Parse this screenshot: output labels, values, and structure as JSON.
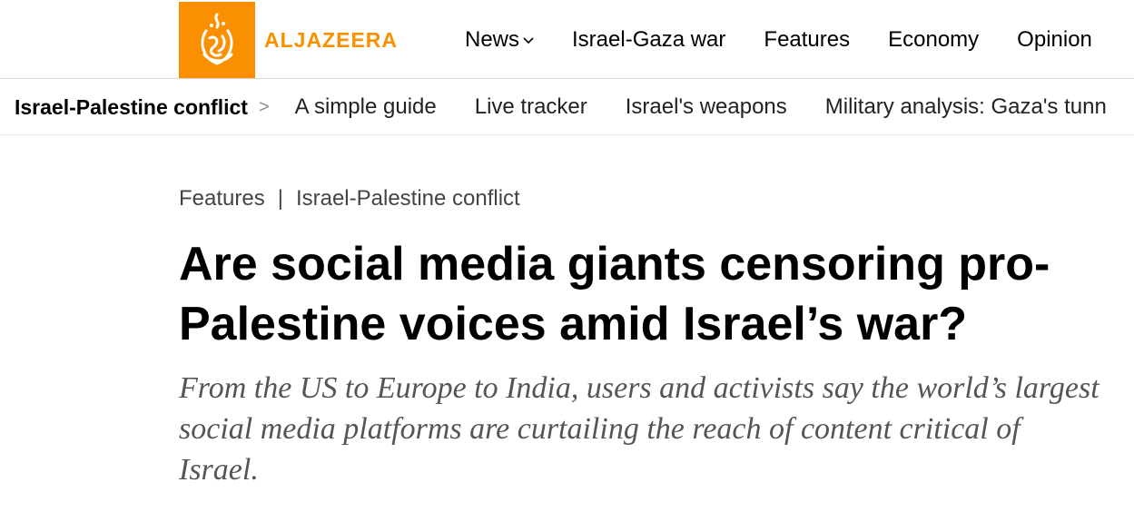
{
  "brand": {
    "name": "ALJAZEERA",
    "accent_color": "#fa9000",
    "logo_icon": "aljazeera-calligraphy-logo"
  },
  "main_nav": {
    "items": [
      {
        "label": "News",
        "has_dropdown": true
      },
      {
        "label": "Israel-Gaza war"
      },
      {
        "label": "Features"
      },
      {
        "label": "Economy"
      },
      {
        "label": "Opinion"
      }
    ]
  },
  "sub_nav": {
    "title": "Israel-Palestine conflict",
    "separator": ">",
    "links": [
      {
        "label": "A simple guide"
      },
      {
        "label": "Live tracker"
      },
      {
        "label": "Israel's weapons"
      },
      {
        "label": "Military analysis: Gaza's tunn"
      }
    ]
  },
  "article": {
    "breadcrumb": {
      "section": "Features",
      "separator": "|",
      "topic": "Israel-Palestine conflict"
    },
    "headline": "Are social media giants censoring pro-Palestine voices amid Israel’s war?",
    "subheadline": "From the US to Europe to India, users and activists say the world’s largest social media platforms are curtailing the reach of content critical of Israel."
  }
}
